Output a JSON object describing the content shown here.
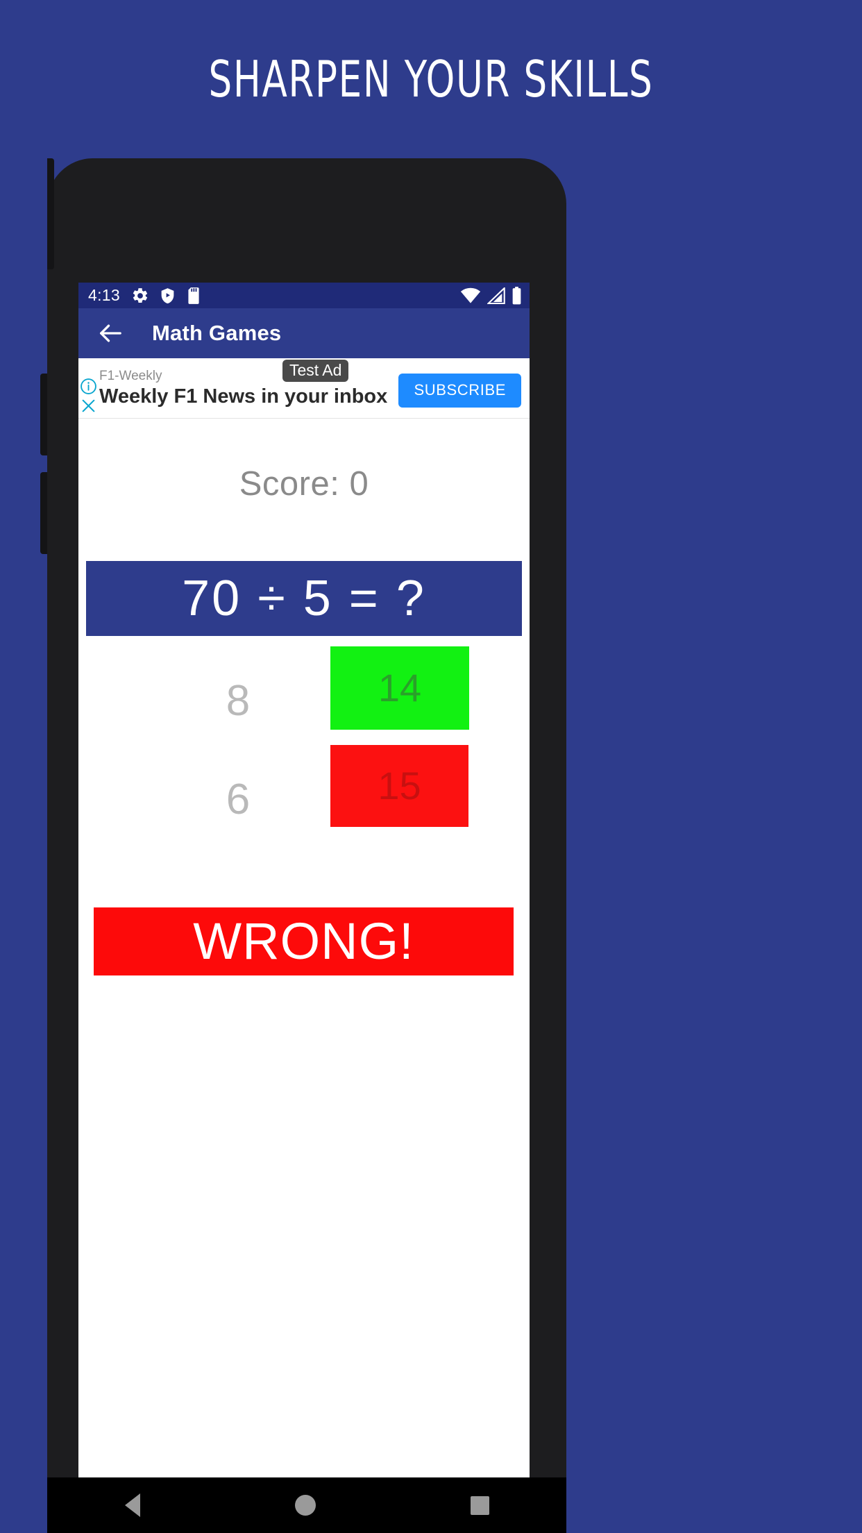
{
  "promo": {
    "headline": "SHARPEN YOUR SKILLS",
    "background_color": "#2e3c8c",
    "text_color": "#ffffff"
  },
  "status_bar": {
    "time": "4:13",
    "background_color": "#1f2a78",
    "left_icons": [
      "gear-icon",
      "shield-play-icon",
      "sd-card-icon"
    ],
    "right_icons": [
      "wifi-icon",
      "cell-signal-icon",
      "battery-icon"
    ]
  },
  "app_bar": {
    "back_icon": "arrow-left-icon",
    "title": "Math Games",
    "background_color": "#2e3c8c"
  },
  "ad": {
    "info_icon": "info-circle-icon",
    "close_icon": "close-x-icon",
    "advertiser": "F1-Weekly",
    "headline": "Weekly F1 News in your inbox",
    "test_label": "Test Ad",
    "cta_label": "SUBSCRIBE",
    "cta_color": "#1e8bff"
  },
  "game": {
    "score_label": "Score: 0",
    "question": "70 ÷ 5 = ?",
    "question_background": "#2e3c8c",
    "options": [
      {
        "value": "8",
        "style": "plain",
        "color": "#b9b9b9"
      },
      {
        "value": "14",
        "style": "filled",
        "background": "#12f112",
        "color": "#2aa02a"
      },
      {
        "value": "6",
        "style": "plain",
        "color": "#b9b9b9"
      },
      {
        "value": "15",
        "style": "filled",
        "background": "#fc1111",
        "color": "#c81010"
      }
    ],
    "result": {
      "text": "WRONG!",
      "background": "#fd0a0a",
      "color": "#ffffff"
    }
  },
  "nav_bar": {
    "back_icon": "triangle-back-icon",
    "home_icon": "circle-home-icon",
    "recents_icon": "square-recents-icon",
    "background_color": "#000000"
  }
}
